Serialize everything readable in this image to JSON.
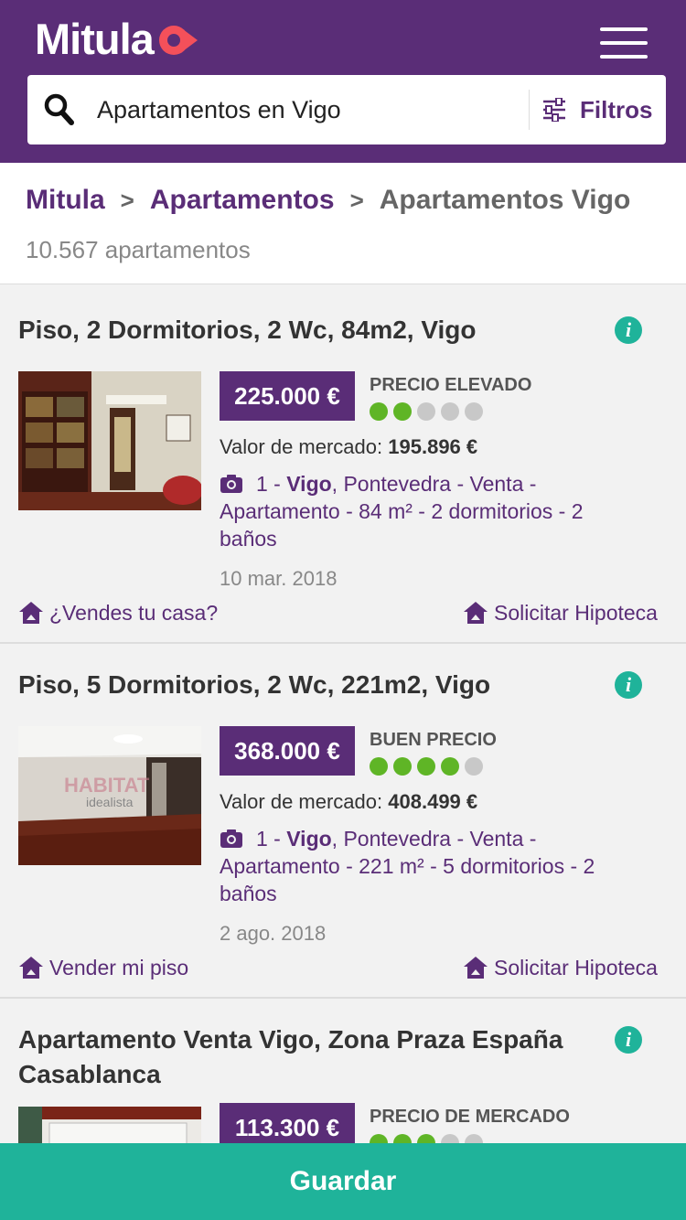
{
  "header": {
    "logo_text": "Mitula",
    "brand_color": "#5a2d77",
    "accent_color": "#f4505a"
  },
  "search": {
    "value": "Apartamentos en Vigo",
    "filters_label": "Filtros"
  },
  "breadcrumb": {
    "items": [
      "Mitula",
      "Apartamentos",
      "Apartamentos Vigo"
    ],
    "separator": ">"
  },
  "results_count": "10.567 apartamentos",
  "listings": [
    {
      "title": "Piso, 2 Dormitorios, 2 Wc, 84m2, Vigo",
      "price": "225.000 €",
      "rating_label": "PRECIO ELEVADO",
      "rating": 2,
      "rating_max": 5,
      "market_label": "Valor de mercado:",
      "market_value": "195.896 €",
      "photo_count": "1",
      "city": "Vigo",
      "details_rest": ", Pontevedra - Venta - Apartamento - 84 m² - 2 dormitorios - 2 baños",
      "date": "10 mar. 2018",
      "action_left": "¿Vendes tu casa?",
      "action_right": "Solicitar Hipoteca"
    },
    {
      "title": "Piso, 5 Dormitorios, 2 Wc, 221m2, Vigo",
      "price": "368.000 €",
      "rating_label": "BUEN PRECIO",
      "rating": 4,
      "rating_max": 5,
      "market_label": "Valor de mercado:",
      "market_value": "408.499 €",
      "photo_count": "1",
      "city": "Vigo",
      "details_rest": ", Pontevedra - Venta - Apartamento - 221 m² - 5 dormitorios - 2 baños",
      "date": "2 ago. 2018",
      "action_left": "Vender mi piso",
      "action_right": "Solicitar Hipoteca",
      "watermark": "idealista"
    },
    {
      "title": "Apartamento Venta Vigo, Zona Praza España Casablanca",
      "price": "113.300 €",
      "rating_label": "PRECIO DE MERCADO",
      "rating": 3,
      "rating_max": 5
    }
  ],
  "info_icon": "i",
  "save_label": "Guardar",
  "save_color": "#1fb39a",
  "rating_on_color": "#5fb526",
  "rating_off_color": "#c8c8c8"
}
